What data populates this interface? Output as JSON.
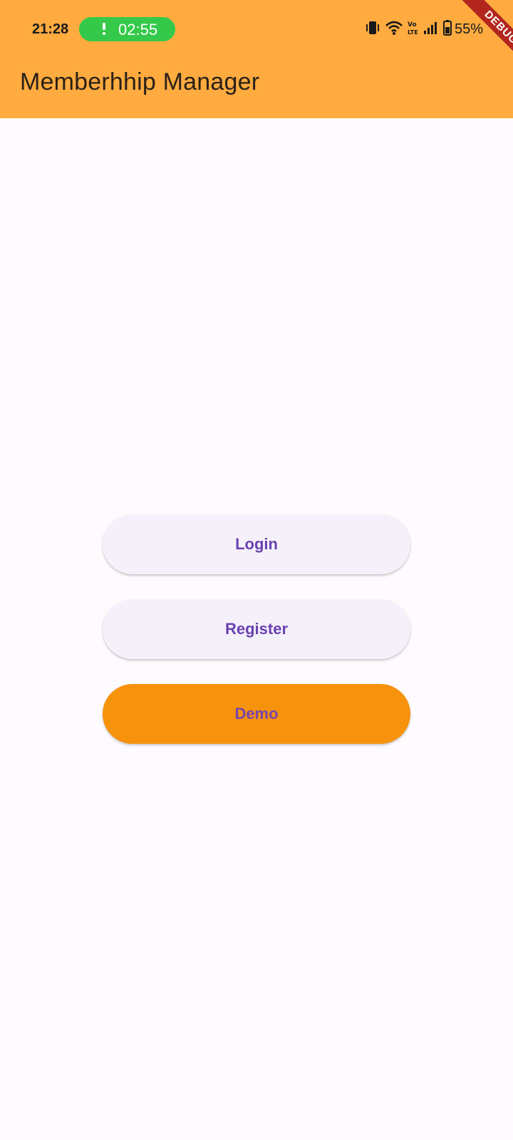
{
  "status_bar": {
    "time": "21:28",
    "call_timer": "02:55",
    "battery_percent": "55%",
    "icons": [
      "vibrate-icon",
      "wifi-icon",
      "volte-icon",
      "signal-icon",
      "battery-icon"
    ]
  },
  "app_bar": {
    "title": "Memberhhip Manager",
    "background_color": "#ffab40"
  },
  "debug_banner": {
    "label": "DEBUG"
  },
  "actions": {
    "login_label": "Login",
    "register_label": "Register",
    "demo_label": "Demo"
  },
  "colors": {
    "primary_text": "#6a41b0",
    "demo_button": "#f6920c",
    "secondary_button": "#f5f1fa",
    "call_chip": "#35c94a",
    "debug_ribbon": "#b3261e"
  }
}
